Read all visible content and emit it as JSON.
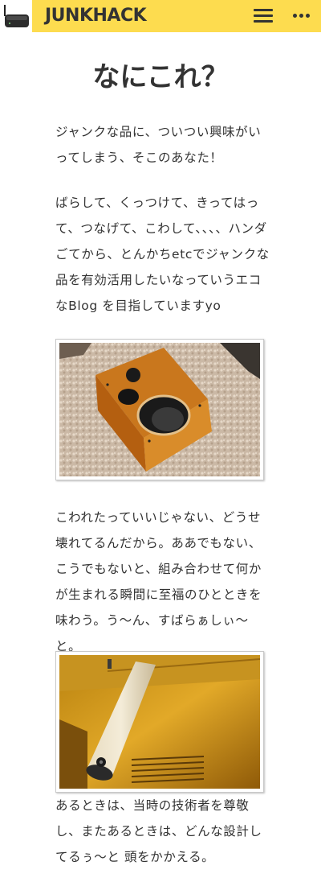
{
  "header": {
    "site_title": "JUNKHACK",
    "logo_icon": "router-logo-icon",
    "menu_icon": "hamburger-icon",
    "more_icon": "more-dots-icon",
    "background": "#fddc4f"
  },
  "main": {
    "page_title": "なにこれ？",
    "paragraph_1": "ジャンクな品に、ついつい興味がいってしまう、そこのあなた！",
    "paragraph_2": "ばらして、くっつけて、きってはって、つなげて、こわして、、、、ハンダごてから、とんかちetcでジャンクな品を有効活用したいなっていうエコなBlog を目指していますyo",
    "photo_1": "speaker-enclosure-photo",
    "paragraph_3": "こわれたっていいじゃない、どうせ壊れてるんだから。ああでもない、こうでもないと、組み合わせて何かが生まれる瞬間に至福のひとときを味わう。う〜ん、すばらぁしぃ〜と。",
    "photo_2": "tube-speaker-photo",
    "paragraph_4": "あるときは、当時の技術者を尊敬し、またあるときは、どんな設計してるぅ〜と 頭をかかえる。"
  }
}
